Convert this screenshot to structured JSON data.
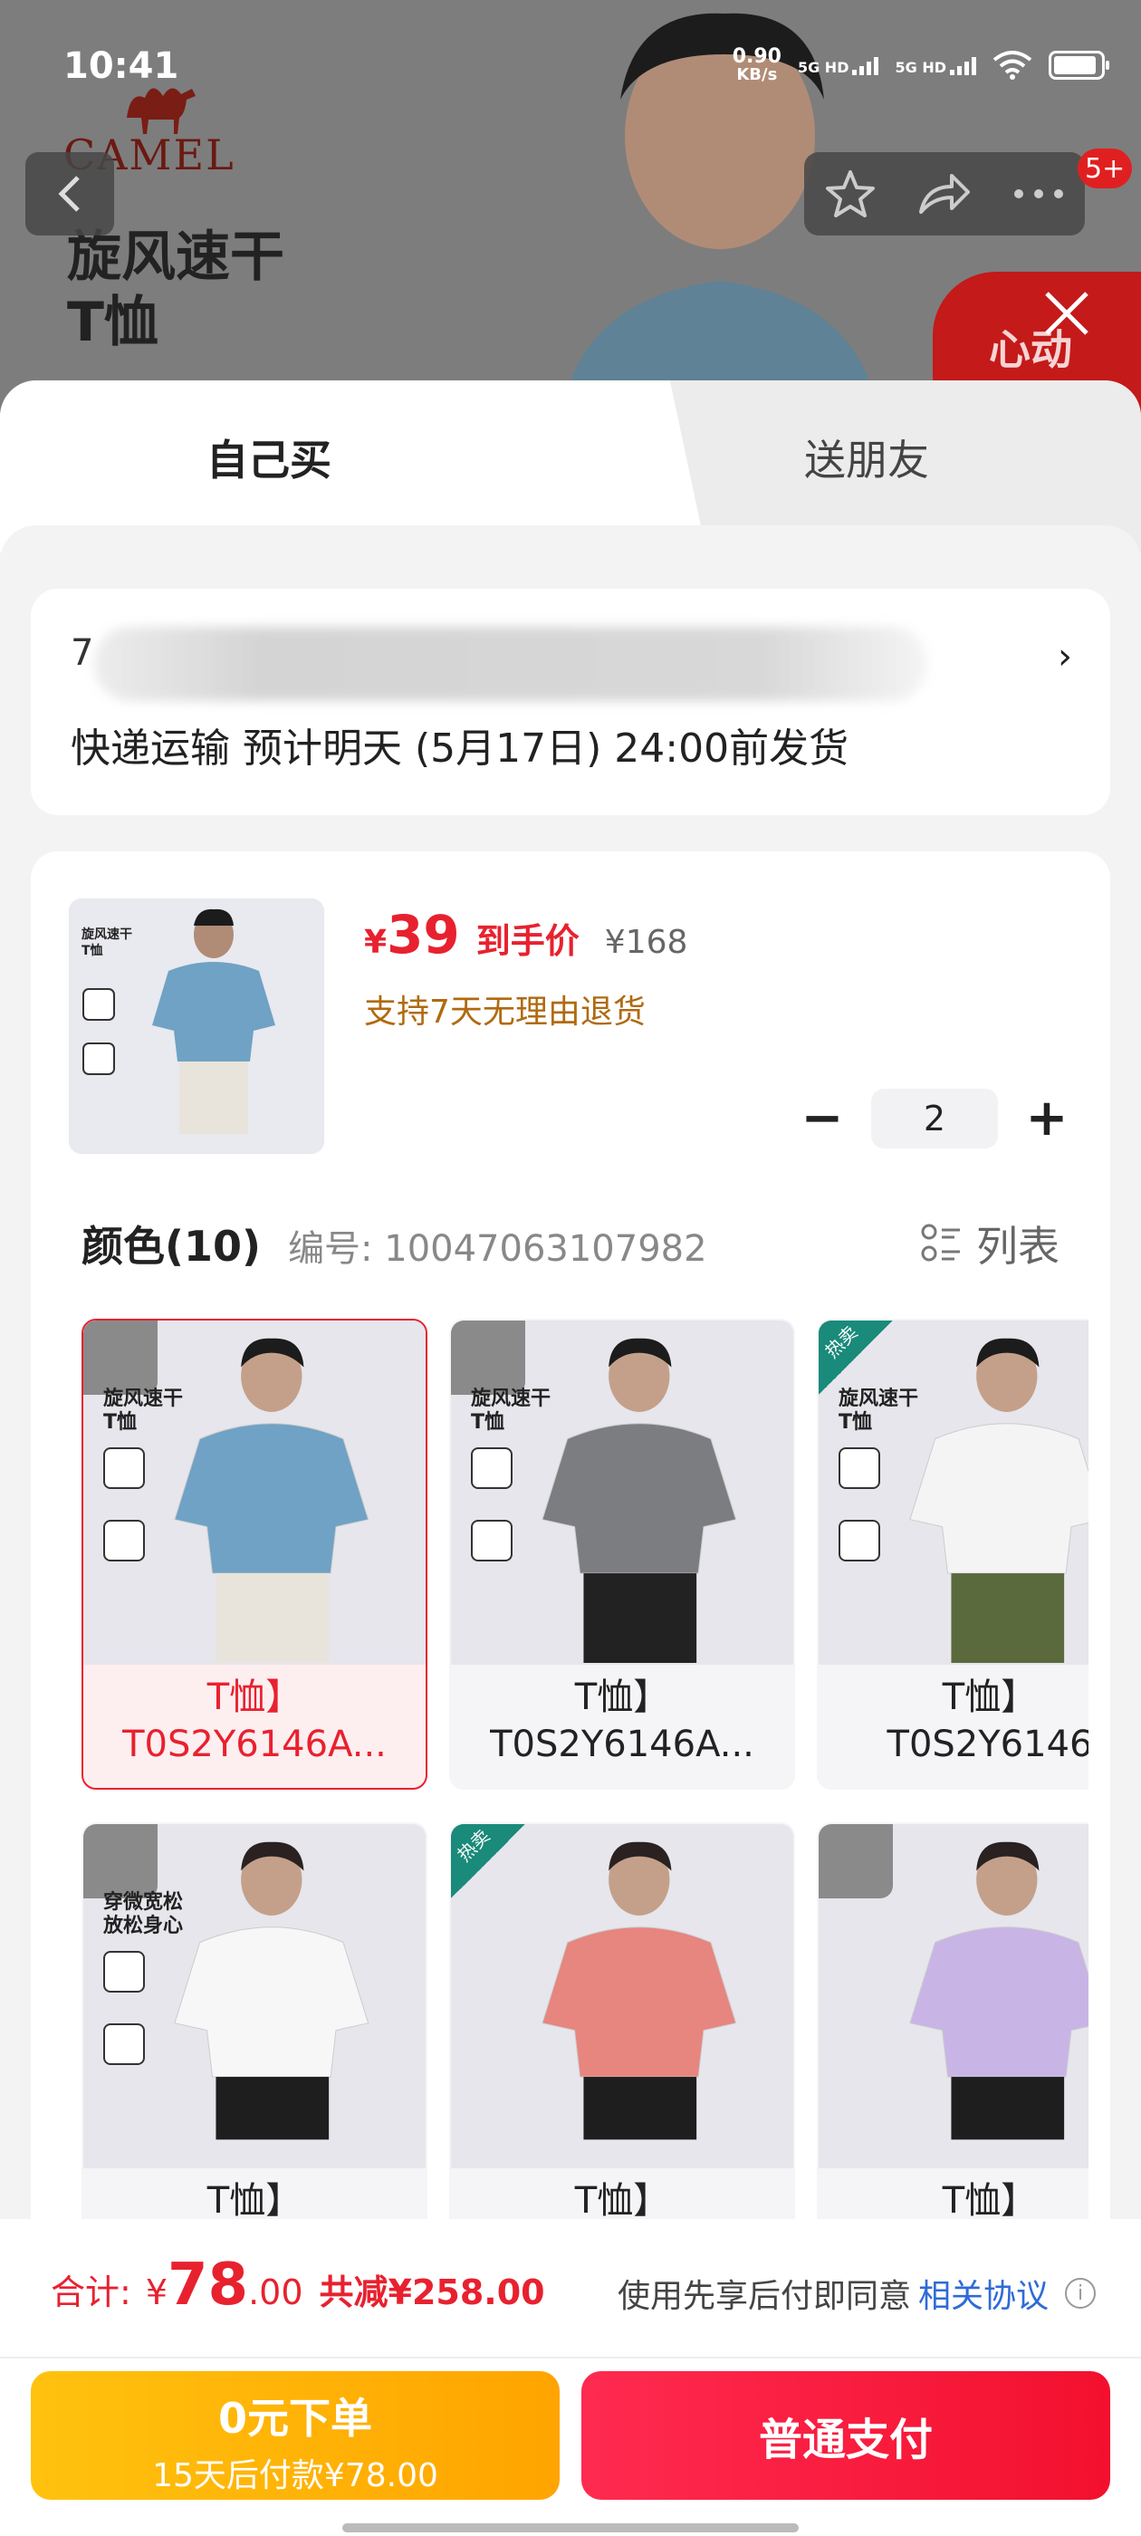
{
  "status_bar": {
    "time": "10:41",
    "net_speed": "0.90",
    "net_unit": "KB/s",
    "sim1": "5G HD",
    "sim2": "5G HD"
  },
  "header": {
    "brand": "CAMEL",
    "product_hero_title_line1": "旋风速干",
    "product_hero_title_line2": "T恤",
    "notification_badge": "5+",
    "promo_text": "心动"
  },
  "tabs": [
    {
      "label": "自己买",
      "active": true
    },
    {
      "label": "送朋友",
      "active": false
    }
  ],
  "address": {
    "prefix": "7",
    "shipping": "快递运输  预计明天 (5月17日) 24:00前发货"
  },
  "product": {
    "currency": "¥",
    "price": "39",
    "price_tag": "到手价",
    "original_price": "¥168",
    "return_policy": "支持7天无理由退货",
    "quantity": "2",
    "color_title": "颜色(10)",
    "sku": "编号: 10047063107982",
    "view_toggle": "列表",
    "variants": [
      {
        "label_line1": "T恤】",
        "label_line2": "T0S2Y6146A...",
        "selected": true,
        "shirt_color": "#6fa2c4",
        "shorts": "#e8e4dc",
        "feature": "旋风速干\nT恤",
        "hot": false
      },
      {
        "label_line1": "T恤】",
        "label_line2": "T0S2Y6146A...",
        "selected": false,
        "shirt_color": "#7c7d80",
        "shorts": "#222222",
        "feature": "旋风速干\nT恤",
        "hot": false
      },
      {
        "label_line1": "T恤】",
        "label_line2": "T0S2Y6146",
        "selected": false,
        "shirt_color": "#f4f4f4",
        "shorts": "#5b6a3c",
        "feature": "旋风速干\nT恤",
        "hot": true
      },
      {
        "label_line1": "T恤】",
        "label_line2": "",
        "selected": false,
        "shirt_color": "#f7f7f7",
        "shorts": "#1e1e1e",
        "feature": "穿微宽松\n放松身心",
        "hot": false
      },
      {
        "label_line1": "T恤】",
        "label_line2": "",
        "selected": false,
        "shirt_color": "#e7857f",
        "shorts": "#1e1e1e",
        "feature": "",
        "hot": true
      },
      {
        "label_line1": "T恤】",
        "label_line2": "",
        "selected": false,
        "shirt_color": "#c9b4e6",
        "shorts": "#1e1e1e",
        "feature": "",
        "hot": false
      }
    ]
  },
  "footer": {
    "total_label": "合计:",
    "currency": "¥",
    "total_int": "78",
    "total_dec": ".00",
    "discount": "共减¥258.00",
    "agreement_prefix": "使用先享后付即同意",
    "agreement_link": "相关协议",
    "btn_later_line1": "0元下单",
    "btn_later_line2": "15天后付款¥78.00",
    "btn_pay": "普通支付"
  }
}
